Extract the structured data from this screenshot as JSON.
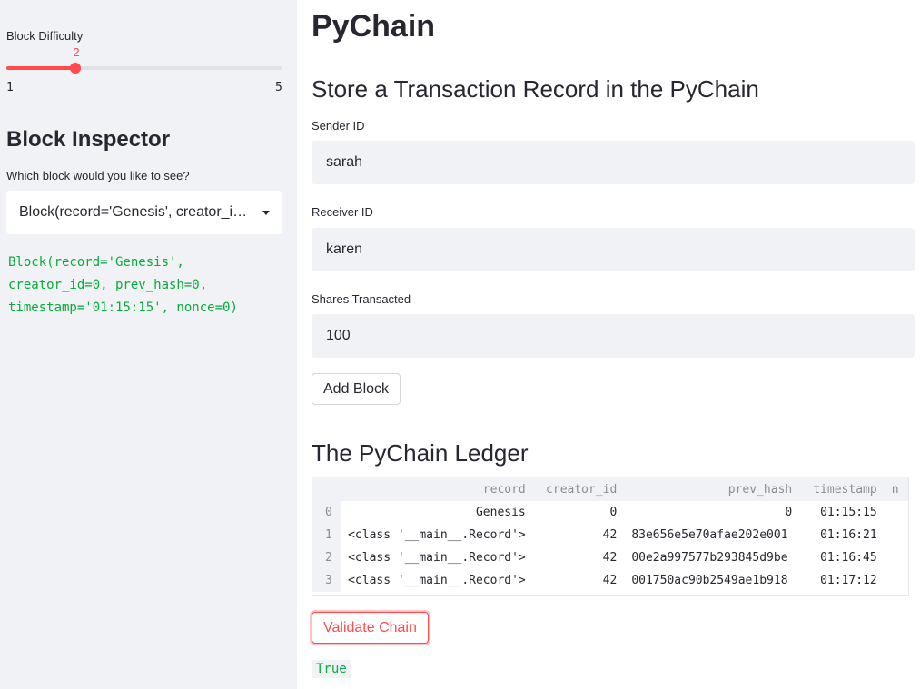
{
  "sidebar": {
    "slider": {
      "label": "Block Difficulty",
      "value": "2",
      "min": "1",
      "max": "5",
      "fraction": 0.25,
      "accent": "#ff4b4b"
    },
    "heading": "Block Inspector",
    "select_label": "Which block would you like to see?",
    "select_value": "Block(record='Genesis', creator_id=0, prev_hash=0, timestamp='01:15:15', nonce=0)",
    "code_lines": [
      "Block(record='Genesis',",
      "creator_id=0, prev_hash=0,",
      "timestamp='01:15:15', nonce=0)"
    ]
  },
  "main": {
    "title": "PyChain",
    "form_heading": "Store a Transaction Record in the PyChain",
    "sender": {
      "label": "Sender ID",
      "value": "sarah"
    },
    "receiver": {
      "label": "Receiver ID",
      "value": "karen"
    },
    "shares": {
      "label": "Shares Transacted",
      "value": "100"
    },
    "add_button": "Add Block",
    "ledger_heading": "The PyChain Ledger",
    "table": {
      "columns": [
        "record",
        "creator_id",
        "prev_hash",
        "timestamp",
        "n"
      ],
      "rows": [
        {
          "index": "0",
          "record": "Genesis",
          "creator_id": "0",
          "prev_hash": "0",
          "timestamp": "01:15:15"
        },
        {
          "index": "1",
          "record": "<class '__main__.Record'>",
          "creator_id": "42",
          "prev_hash": "83e656e5e70afae202e001",
          "timestamp": "01:16:21"
        },
        {
          "index": "2",
          "record": "<class '__main__.Record'>",
          "creator_id": "42",
          "prev_hash": "00e2a997577b293845d9be",
          "timestamp": "01:16:45"
        },
        {
          "index": "3",
          "record": "<class '__main__.Record'>",
          "creator_id": "42",
          "prev_hash": "001750ac90b2549ae1b918",
          "timestamp": "01:17:12"
        }
      ]
    },
    "validate_button": "Validate Chain",
    "validate_result": "True"
  }
}
